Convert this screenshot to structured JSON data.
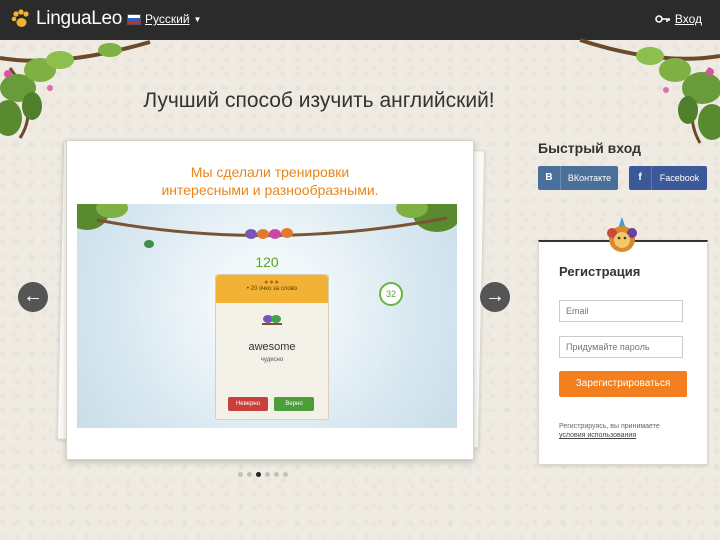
{
  "header": {
    "logo_text": "LinguaLeo",
    "language_label": "Русский",
    "login_label": "Вход"
  },
  "headline": "Лучший способ изучить английский!",
  "carousel": {
    "title_line1": "Мы сделали тренировки",
    "title_line2": "интересными и разнообразными.",
    "game": {
      "score": "120",
      "timer": "32",
      "card_header": "• 20 очко за слово",
      "word": "awesome",
      "translation": "чудесно",
      "wrong_label": "Неверно",
      "right_label": "Верно"
    },
    "prev_arrow": "←",
    "next_arrow": "→",
    "slides_count": 6,
    "active_slide": 3
  },
  "quick_login": {
    "title": "Быстрый вход",
    "vk_label": "ВКонтакте",
    "vk_icon": "В",
    "fb_label": "Facebook",
    "fb_icon": "f"
  },
  "registration": {
    "title": "Регистрация",
    "email_placeholder": "Email",
    "password_placeholder": "Придумайте пароль",
    "submit_label": "Зарегистрироваться",
    "terms_text": "Регистрируясь, вы принимаете",
    "terms_link": "условия использования"
  },
  "colors": {
    "accent_orange": "#f27e1d",
    "vk_blue": "#4a6f99",
    "fb_blue": "#3b5998",
    "topbar": "#2b2b2b"
  }
}
